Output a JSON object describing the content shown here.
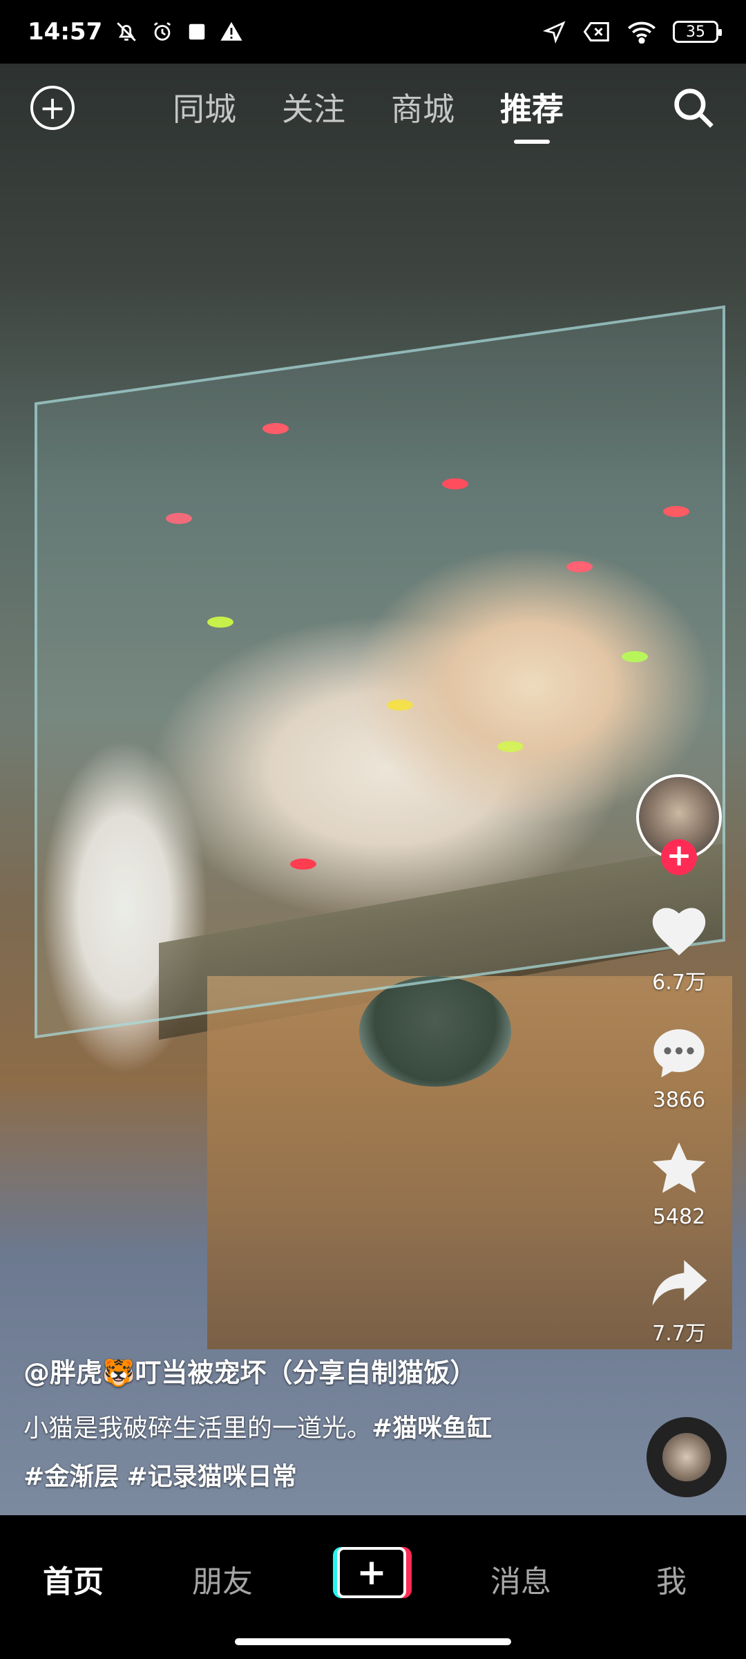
{
  "status_bar": {
    "time": "14:57",
    "battery": "35",
    "left_icons": [
      "bell-off-icon",
      "alarm-icon",
      "square-icon",
      "warning-icon"
    ],
    "right_icons": [
      "location-arrow-icon",
      "no-sim-icon",
      "wifi-icon",
      "battery-icon"
    ]
  },
  "top_nav": {
    "tabs": [
      {
        "label": "同城",
        "active": false
      },
      {
        "label": "关注",
        "active": false
      },
      {
        "label": "商城",
        "active": false
      },
      {
        "label": "推荐",
        "active": true
      }
    ]
  },
  "right_rail": {
    "likes": "6.7万",
    "comments": "3866",
    "favorites": "5482",
    "shares": "7.7万",
    "follow_symbol": "+"
  },
  "caption": {
    "author": "@胖虎🐯叮当被宠坏（分享自制猫饭）",
    "text": "小猫是我破碎生活里的一道光。",
    "tags": [
      "#猫咪鱼缸",
      "#金渐层",
      "#记录猫咪日常"
    ]
  },
  "bottom_nav": {
    "items": [
      {
        "label": "首页",
        "active": true
      },
      {
        "label": "朋友",
        "active": false
      },
      {
        "label": "消息",
        "active": false
      },
      {
        "label": "我",
        "active": false
      }
    ],
    "create_symbol": "+"
  },
  "colors": {
    "accent_red": "#fe2c55",
    "accent_cyan": "#25f4ee"
  }
}
